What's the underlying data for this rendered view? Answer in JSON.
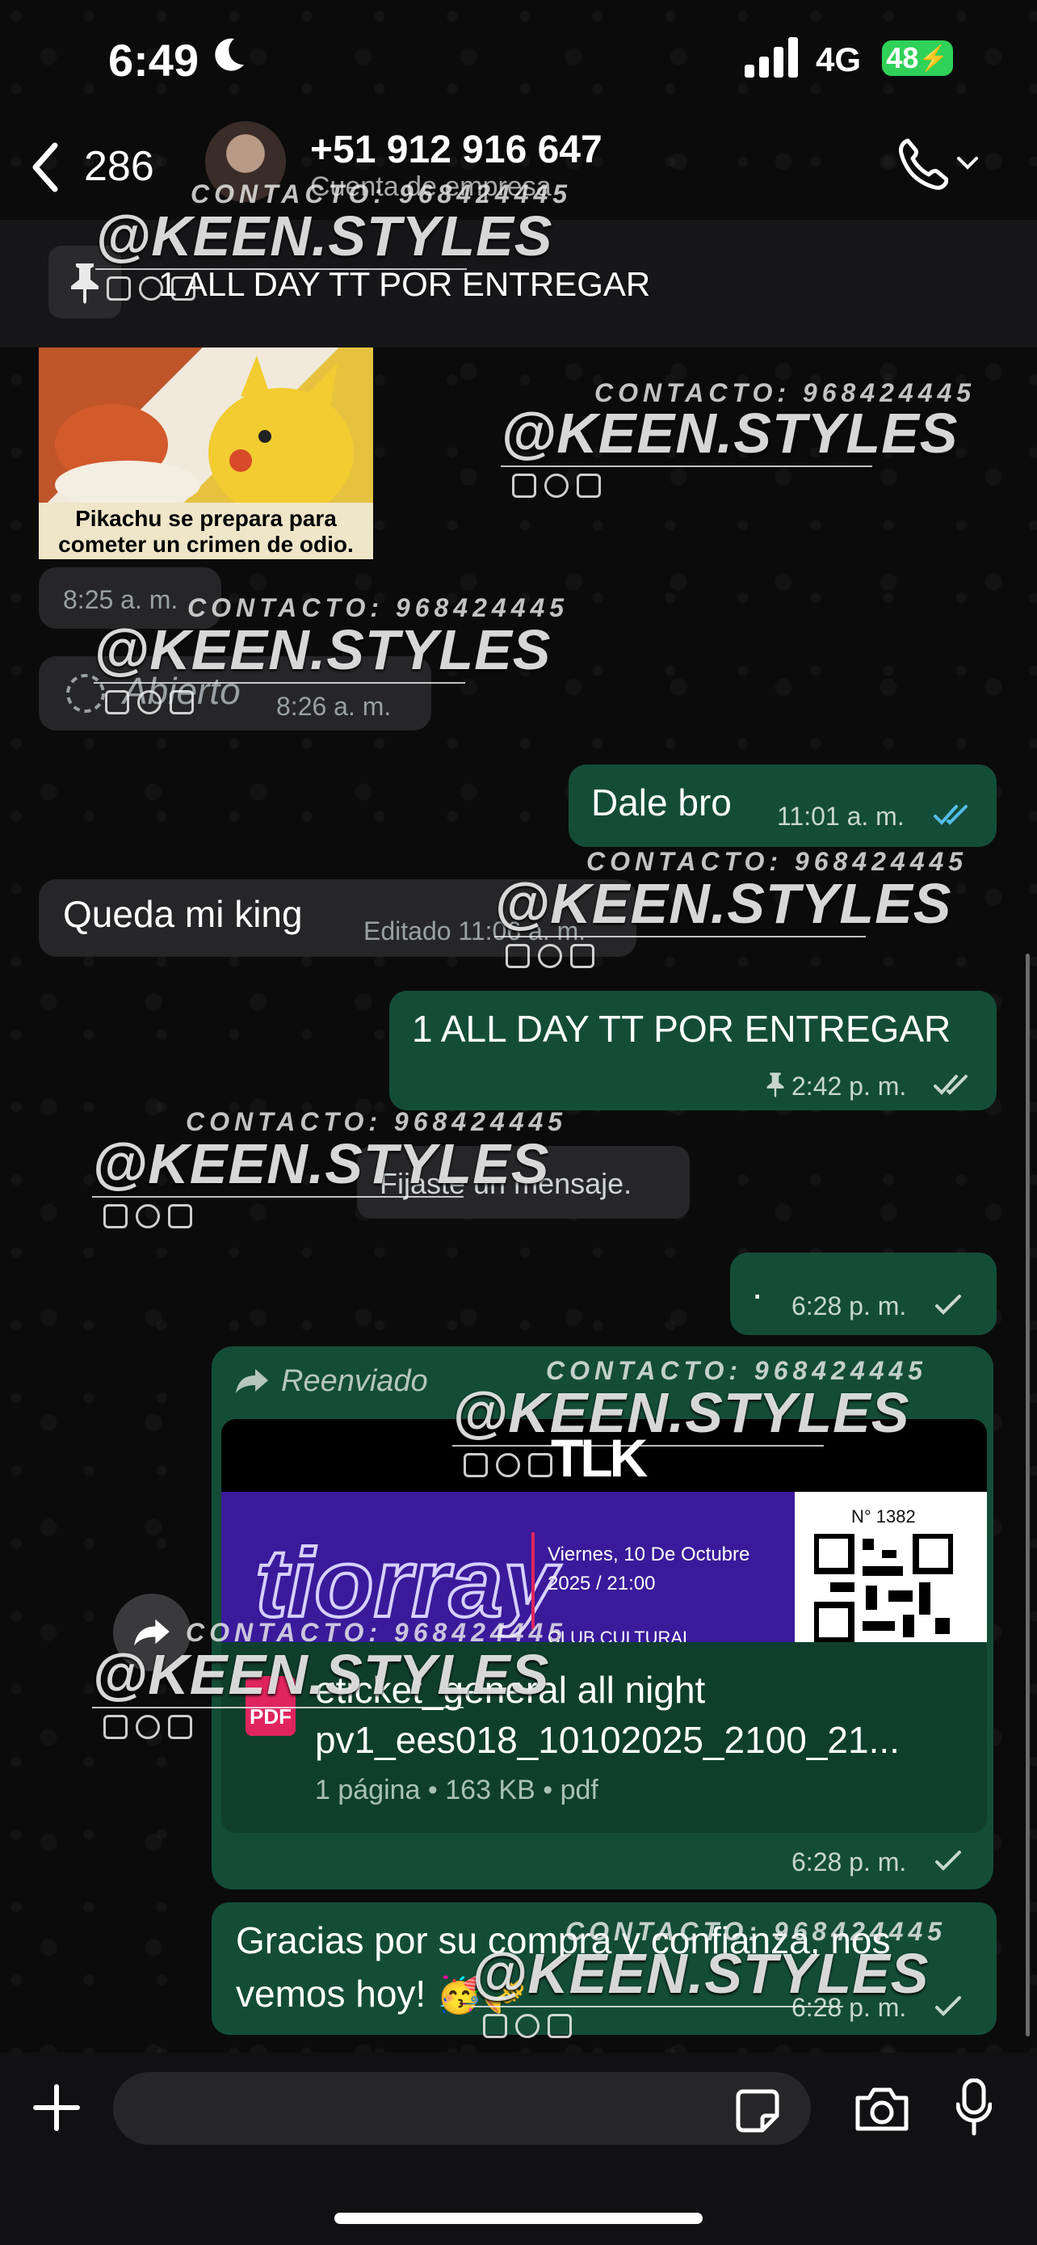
{
  "status_bar": {
    "time": "6:49",
    "network": "4G",
    "battery": "48"
  },
  "header": {
    "back_count": "286",
    "contact_name": "+51 912 916 647",
    "contact_subtitle": "Cuenta de empresa"
  },
  "pinned": {
    "text": "1 ALL DAY TT POR ENTREGAR"
  },
  "watermark": {
    "contact": "CONTACTO: 968424445",
    "handle": "@KEEN.STYLES"
  },
  "messages": {
    "meme": {
      "caption": "Pikachu se prepara para cometer un crimen de odio.",
      "time": "8:25 a. m."
    },
    "status": {
      "label": "Abierto",
      "time": "8:26 a. m."
    },
    "dale": {
      "text": "Dale bro",
      "time": "11:01 a. m."
    },
    "queda": {
      "text": "Queda mi king",
      "meta": "Editado 11:06 a. m."
    },
    "pinned_msg": {
      "text": "1 ALL DAY TT POR ENTREGAR",
      "time": "2:42 p. m."
    },
    "system": {
      "text": "Fijaste un mensaje."
    },
    "dot": {
      "text": "·",
      "time": "6:28 p. m."
    },
    "ticket": {
      "forwarded_label": "Reenviado",
      "brand": "TLK",
      "ticket_number": "N° 1382",
      "date": "Viernes, 10 De Octubre",
      "datetime": "2025 / 21:00",
      "venue": "CLUB CULTURAL",
      "file_name_line1": "eticket_general all night",
      "file_name_line2": "pv1_ees018_10102025_2100_21...",
      "file_meta": "1 página • 163 KB • pdf",
      "file_type": "PDF",
      "time": "6:28 p. m."
    },
    "gracias": {
      "line1": "Gracias por su compra y confianza, nos",
      "line2": "vemos hoy! 🥳🎺",
      "time": "6:28 p. m."
    }
  },
  "input": {
    "placeholder": ""
  },
  "colors": {
    "outgoing": "#144d37",
    "incoming": "#262628",
    "read_check": "#53bdeb",
    "accent": "#25d366"
  }
}
